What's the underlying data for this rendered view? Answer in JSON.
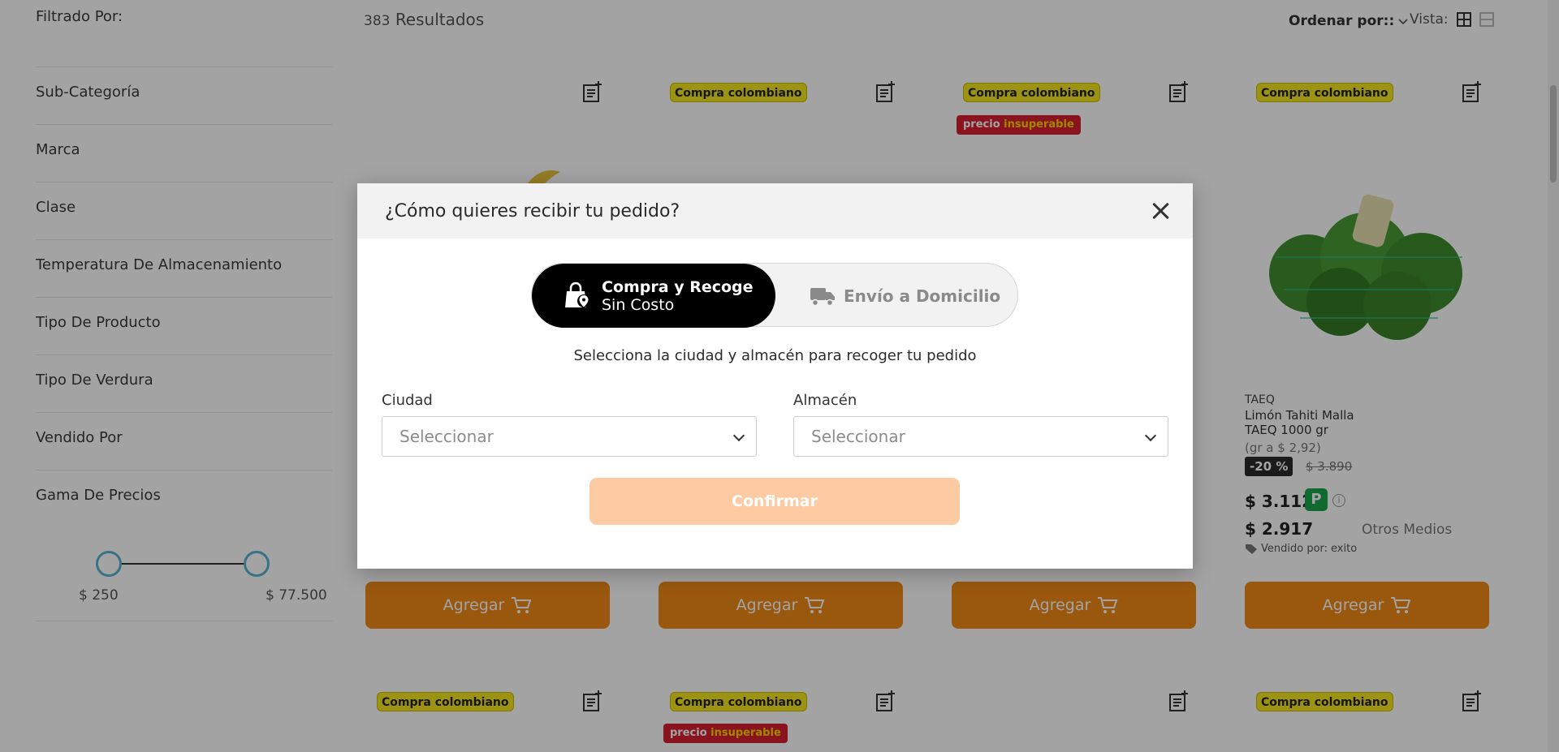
{
  "filters": {
    "title": "Filtrado Por:",
    "items": [
      "Sub-Categoría",
      "Marca",
      "Clase",
      "Temperatura De Almacenamiento",
      "Tipo De Producto",
      "Tipo De Verdura",
      "Vendido Por",
      "Gama De Precios"
    ],
    "price_min": "$ 250",
    "price_max": "$ 77.500"
  },
  "results": {
    "count": "383",
    "label": "Resultados"
  },
  "sort": {
    "label": "Ordenar por::"
  },
  "view": {
    "label": "Vista:"
  },
  "badges": {
    "compra_colombiano": "Compra colombiano",
    "precio": "precio",
    "insuperable": "insuperable"
  },
  "product": {
    "brand": "TAEQ",
    "name": "Limón Tahiti Malla TAEQ 1000 gr",
    "unit_price": "(gr a $ 2,92)",
    "discount": "-20 %",
    "old_price": "$ 3.890",
    "price_card": "$ 3.112",
    "price_other": "$ 2.917",
    "other_label": "Otros Medios",
    "seller_label": "Vendido por:",
    "seller": "exito"
  },
  "add_button": "Agregar",
  "modal": {
    "title": "¿Cómo quieres recibir tu pedido?",
    "option_pickup_title": "Compra y Recoge",
    "option_pickup_sub": "Sin Costo",
    "option_delivery": "Envío a Domicilio",
    "instruction": "Selecciona la ciudad y almacén para recoger tu pedido",
    "city_label": "Ciudad",
    "city_placeholder": "Seleccionar",
    "store_label": "Almacén",
    "store_placeholder": "Seleccionar",
    "confirm": "Confirmar"
  },
  "colors": {
    "accent": "#ef8a17",
    "confirm_disabled": "#fccba4",
    "badge_yellow": "#f5e51e",
    "promo_red": "#d61f2f"
  }
}
